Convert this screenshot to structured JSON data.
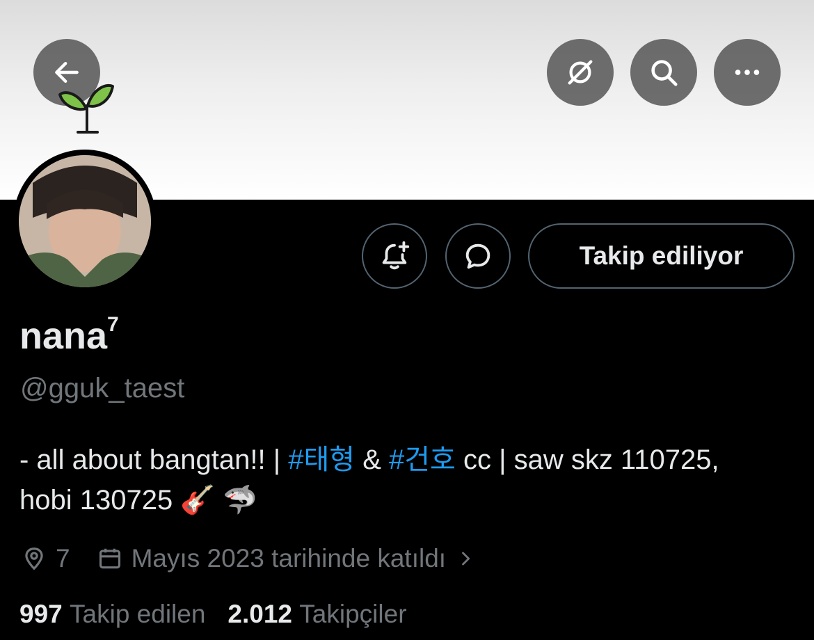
{
  "header": {
    "back_icon": "arrow-left-icon",
    "actions": [
      "grok-icon",
      "search-icon",
      "more-icon"
    ],
    "banner_decoration": "seedling-icon"
  },
  "profile": {
    "follow_button_label": "Takip ediliyor",
    "notify_icon": "bell-plus-icon",
    "message_icon": "message-icon",
    "display_name": "nana",
    "display_name_sup": "7",
    "handle": "@gguk_taest",
    "bio": {
      "part1": "- all about bangtan!! | ",
      "tag1": "#태형",
      "part2": " & ",
      "tag2": "#건호",
      "part3": " cc | saw skz 110725,",
      "line2": "hobi 130725 🎸 🦈"
    },
    "location": "7",
    "joined": "Mayıs 2023 tarihinde katıldı",
    "following_count": "997",
    "following_label": "Takip edilen",
    "followers_count": "2.012",
    "followers_label": "Takipçiler"
  },
  "colors": {
    "link": "#1d9bf0",
    "secondary_text": "#71767b",
    "primary_text": "#e7e9ea",
    "background": "#000000"
  }
}
